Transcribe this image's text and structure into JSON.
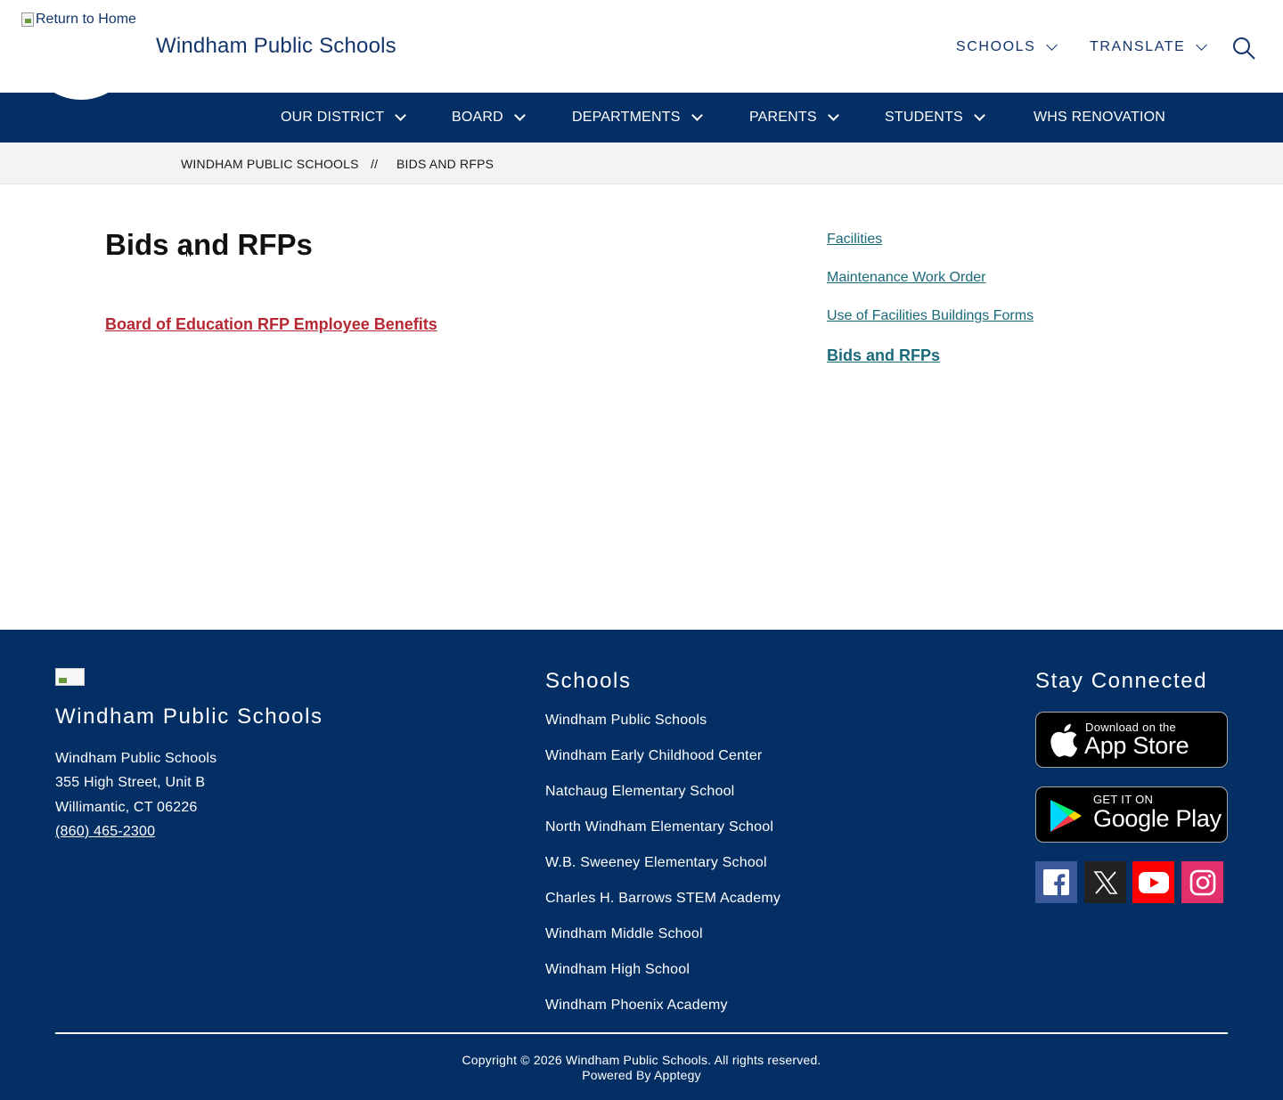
{
  "header": {
    "home_link_alt": "Return to Home",
    "site_title": "Windham Public Schools",
    "schools_label": "SCHOOLS",
    "translate_label": "TRANSLATE"
  },
  "nav": {
    "items": [
      {
        "label": "OUR DISTRICT"
      },
      {
        "label": "BOARD"
      },
      {
        "label": "DEPARTMENTS"
      },
      {
        "label": "PARENTS"
      },
      {
        "label": "STUDENTS"
      },
      {
        "label": "WHS RENOVATION"
      }
    ]
  },
  "breadcrumb": {
    "home": "WINDHAM PUBLIC SCHOOLS",
    "separator": "//",
    "current": "BIDS AND RFPS"
  },
  "main": {
    "title": "Bids and RFPs",
    "document_link": "Board of Education RFP Employee Benefits"
  },
  "sidebar": {
    "links": [
      {
        "label": "Facilities"
      },
      {
        "label": "Maintenance Work Order"
      },
      {
        "label": "Use of Facilities Buildings Forms"
      },
      {
        "label": "Bids and RFPs"
      }
    ]
  },
  "footer": {
    "title": "Windham Public Schools",
    "address": {
      "name": "Windham Public Schools",
      "street": "355 High Street, Unit B",
      "city": "Willimantic, CT 06226",
      "phone": "(860) 465-2300"
    },
    "schools_heading": "Schools",
    "schools": [
      "Windham Public Schools",
      "Windham Early Childhood Center",
      "Natchaug Elementary School",
      "North Windham Elementary School",
      "W.B. Sweeney Elementary School",
      "Charles H. Barrows STEM Academy",
      "Windham Middle School",
      "Windham High School",
      "Windham Phoenix Academy"
    ],
    "connected_heading": "Stay Connected",
    "app_store": {
      "small": "Download on the",
      "big": "App Store"
    },
    "google_play": {
      "small": "GET IT ON",
      "big": "Google Play"
    },
    "copyright": "Copyright © 2026 Windham Public Schools. All rights reserved.",
    "powered_by": "Powered By Apptegy",
    "colors": {
      "facebook": "#3b5998",
      "x": "#222222",
      "youtube": "#ff0000",
      "instagram": "#e1306c"
    }
  }
}
